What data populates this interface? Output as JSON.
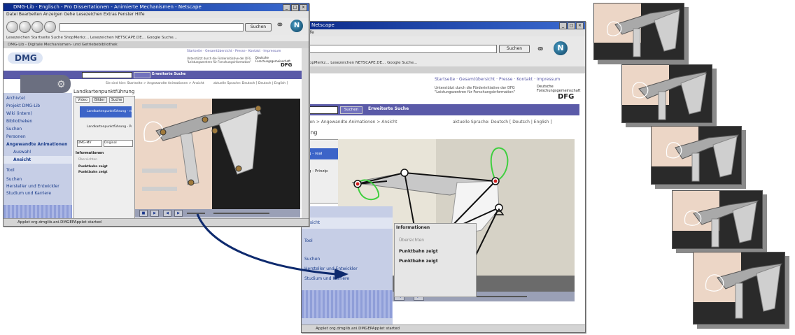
{
  "window_front": {
    "title": "DMG-Lib - Englisch - Pro Dissertationen - Animierte Mechanismen - Netscape",
    "menu": "Datei  Bearbeiten  Anzeigen  Gehe  Lesezeichen  Extras  Fenster  Hilfe",
    "url": "",
    "search_label": "Suchen",
    "bookmarks": "Lesezeichen   Startseite   Suche   ShopMerkz...   Lesezeichen   NETSCAPE.DE...   Google Suche...",
    "tab": "DMG-Lib - Digitale Mechanismen- und Getriebebibliothek",
    "logo": "DMG",
    "header_links": "Startseite · Gesamtübersicht · Presse · Kontakt · Impressum",
    "funding_text": "Unterstützt durch die Förderinitiative der DFG \"Leistungszentren für Forschungsinformation\"",
    "dfg_label": "Deutsche Forschungsgemeinschaft",
    "dfg_short": "DFG",
    "erweiterte_suche": "Erweiterte Suche",
    "breadcrumb": "Sie sind hier: Startseite > Angewandte Animationen > Ansicht",
    "language": "aktuelle Sprache: Deutsch    [ Deutsch | English ]",
    "page_heading": "Landkartenpunktführung",
    "sidebar": [
      "Archiv(e)",
      "Projekt DMG-Lib",
      "Wiki (intern)",
      "Bibliotheken",
      "Suchen",
      "Personen",
      "Angewandte Animationen",
      "Auswahl",
      "Ansicht",
      "Tool",
      "Suchen",
      "Hersteller und Entwickler",
      "Studium und Karriere"
    ],
    "panel_tabs": [
      "Video",
      "Bilder",
      "Suche"
    ],
    "panel_items": [
      "Landkartenpunktführung - real",
      "Landkartenpunktführung - Prinzip"
    ],
    "version_select": "DMG-MV",
    "quality_select": "Original",
    "info_heading": "Informationen",
    "info_items": [
      "Übersichten",
      "Punktbahn zeigt",
      "Punktbahn zeigt"
    ],
    "status": "Applet org.dmglib.ani.DMGEPApplet started"
  },
  "window_back": {
    "title": "Netscape",
    "menu": "Hilfe",
    "search_label": "Suchen",
    "bookmarks": "ShopMerkz...   Lesezeichen   NETSCAPE.DE...   Google Suche...",
    "header_links": "Startseite · Gesamtübersicht · Presse · Kontakt · Impressum",
    "funding_text": "Unterstützt durch die Förderinitiative der DFG \"Leistungszentren für Forschungsinformation\"",
    "dfg_label": "Deutsche Forschungsgemeinschaft",
    "dfg_short": "DFG",
    "erweiterte_suche": "Erweiterte Suche",
    "search_button": "Suchen",
    "breadcrumb": "onen > Angewandte Animationen > Ansicht",
    "language": "aktuelle Sprache: Deutsch   [ Deutsch | English ]",
    "page_heading": "rung",
    "sidebar": [
      "Ansicht",
      "Tool",
      "Suchen",
      "Hersteller und Entwickler",
      "Studium und Karriere"
    ],
    "panel_items": [
      "ung - real",
      "ung - Prinzip"
    ],
    "info_heading": "Informationen",
    "info_items": [
      "Übersichten",
      "Punktbahn zeigt",
      "Punktbahn zeigt"
    ],
    "status": "Applet org.dmglib.ani.DMGEPApplet started"
  },
  "colors": {
    "title_blue": "#0b2a8a",
    "banner_purple": "#5a5aa8",
    "link_blue": "#1a3c8a",
    "arrow_navy": "#0e2a6e",
    "curve_green": "#3fcf3f",
    "beige": "#ecd6c6"
  }
}
